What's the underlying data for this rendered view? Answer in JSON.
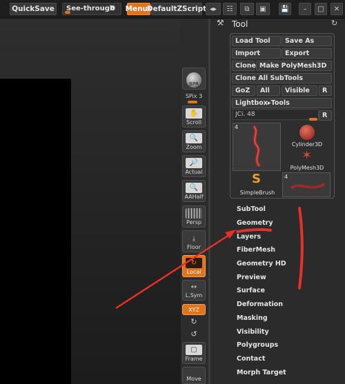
{
  "topbar": {
    "quicksave": "QuickSave",
    "see_through_label": "See-through",
    "see_through_value": "0",
    "menus": "Menus",
    "default_zscript": "DefaultZScript"
  },
  "shelf": {
    "bpr": "BPR",
    "spix_label": "SPix",
    "spix_value": "3",
    "scroll": "Scroll",
    "zoom": "Zoom",
    "actual": "Actual",
    "aahalf": "AAHalf",
    "persp": "Persp",
    "floor": "Floor",
    "local": "Local",
    "lsym": "L.Sym",
    "xyz": "XYZ",
    "frame": "Frame",
    "move": "Move"
  },
  "tool_panel": {
    "title": "Tool",
    "load_tool": "Load Tool",
    "save_as": "Save As",
    "import": "Import",
    "export": "Export",
    "clone": "Clone",
    "make_polymesh": "Make PolyMesh3D",
    "clone_all": "Clone All SubTools",
    "goz": "GoZ",
    "all": "All",
    "visible": "Visible",
    "r": "R",
    "lightbox_tools": "Lightbox▸Tools",
    "slider_label": "JCi. 48",
    "thumbs": [
      {
        "num": "4",
        "label": ""
      },
      {
        "num": "",
        "label": "Cylinder3D"
      },
      {
        "num": "",
        "label": "PolyMesh3D"
      },
      {
        "num": "",
        "label": "SimpleBrush"
      },
      {
        "num": "4",
        "label": ""
      }
    ]
  },
  "menu_items": [
    "SubTool",
    "Geometry",
    "Layers",
    "FiberMesh",
    "Geometry HD",
    "Preview",
    "Surface",
    "Deformation",
    "Masking",
    "Visibility",
    "Polygroups",
    "Contact",
    "Morph Target"
  ],
  "colors": {
    "accent": "#e0741e",
    "annotation": "#e8302a"
  }
}
